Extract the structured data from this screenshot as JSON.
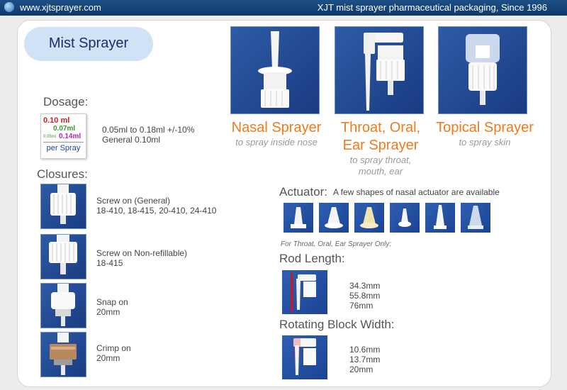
{
  "topbar": {
    "url": "www.xjtsprayer.com",
    "tagline": "XJT mist sprayer pharmaceutical packaging, Since 1996"
  },
  "header": {
    "title": "Mist Sprayer"
  },
  "dosage": {
    "heading": "Dosage:",
    "card": {
      "v1": "0.10 ml",
      "v2": "0.07ml",
      "v3small": "0.05ml",
      "v3": "0.14ml",
      "unit": "per Spray"
    },
    "range": "0.05ml to 0.18ml +/-10%",
    "general": "General 0.10ml"
  },
  "closures": {
    "heading": "Closures:",
    "items": [
      {
        "line1": "Screw on (General)",
        "line2": "18-410, 18-415, 20-410, 24-410"
      },
      {
        "line1": "Screw on Non-refillable)",
        "line2": "18-415"
      },
      {
        "line1": "Snap on",
        "line2": "20mm"
      },
      {
        "line1": "Crimp on",
        "line2": "20mm"
      }
    ]
  },
  "products": [
    {
      "title": "Nasal Sprayer",
      "subtitle": "to spray inside nose"
    },
    {
      "title_line1": "Throat, Oral,",
      "title_line2": "Ear Sprayer",
      "subtitle_line1": "to spray throat,",
      "subtitle_line2": "mouth, ear"
    },
    {
      "title": "Topical Sprayer",
      "subtitle": "to spray skin"
    }
  ],
  "actuator": {
    "heading": "Actuator:",
    "description": "A few shapes of nasal actuator are available",
    "shapes": [
      "white-conical-actuator",
      "white-bell-actuator",
      "cream-actuator",
      "white-round-actuator",
      "white-tall-actuator",
      "translucent-actuator"
    ]
  },
  "throat_note": "For Throat, Oral, Ear Sprayer Only:",
  "rod_length": {
    "heading": "Rod Length:",
    "values": [
      "34.3mm",
      "55.8mm",
      "76mm"
    ]
  },
  "rotating": {
    "heading": "Rotating Block Width:",
    "values": [
      "10.6mm",
      "13.7mm",
      "20mm"
    ]
  },
  "colors": {
    "brand_blue": "#1d4f86",
    "orange": "#f07a1c",
    "pill": "#cfe2f6"
  }
}
